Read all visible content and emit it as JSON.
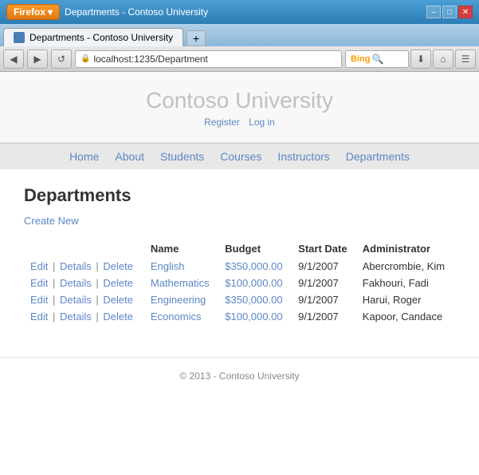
{
  "titlebar": {
    "firefox_label": "Firefox",
    "minimize": "–",
    "maximize": "□",
    "close": "✕"
  },
  "tab": {
    "title": "Departments - Contoso University",
    "new_tab": "+"
  },
  "navbar": {
    "back": "◀",
    "forward": "▶",
    "refresh": "↺",
    "url": "localhost:1235/Department",
    "bing": "Bing",
    "home": "⌂"
  },
  "header": {
    "site_title": "Contoso University",
    "register": "Register",
    "login": "Log in"
  },
  "nav": {
    "items": [
      {
        "label": "Home",
        "href": "#"
      },
      {
        "label": "About",
        "href": "#"
      },
      {
        "label": "Students",
        "href": "#"
      },
      {
        "label": "Courses",
        "href": "#"
      },
      {
        "label": "Instructors",
        "href": "#"
      },
      {
        "label": "Departments",
        "href": "#"
      }
    ]
  },
  "main": {
    "heading": "Departments",
    "create_link": "Create New"
  },
  "table": {
    "headers": [
      "",
      "Name",
      "Budget",
      "Start Date",
      "Administrator"
    ],
    "rows": [
      {
        "actions": [
          "Edit",
          "Details",
          "Delete"
        ],
        "name": "English",
        "budget": "$350,000.00",
        "start_date": "9/1/2007",
        "admin": "Abercrombie, Kim"
      },
      {
        "actions": [
          "Edit",
          "Details",
          "Delete"
        ],
        "name": "Mathematics",
        "budget": "$100,000.00",
        "start_date": "9/1/2007",
        "admin": "Fakhouri, Fadi"
      },
      {
        "actions": [
          "Edit",
          "Details",
          "Delete"
        ],
        "name": "Engineering",
        "budget": "$350,000.00",
        "start_date": "9/1/2007",
        "admin": "Harui, Roger"
      },
      {
        "actions": [
          "Edit",
          "Details",
          "Delete"
        ],
        "name": "Economics",
        "budget": "$100,000.00",
        "start_date": "9/1/2007",
        "admin": "Kapoor, Candace"
      }
    ]
  },
  "footer": {
    "text": "© 2013 - Contoso University"
  }
}
